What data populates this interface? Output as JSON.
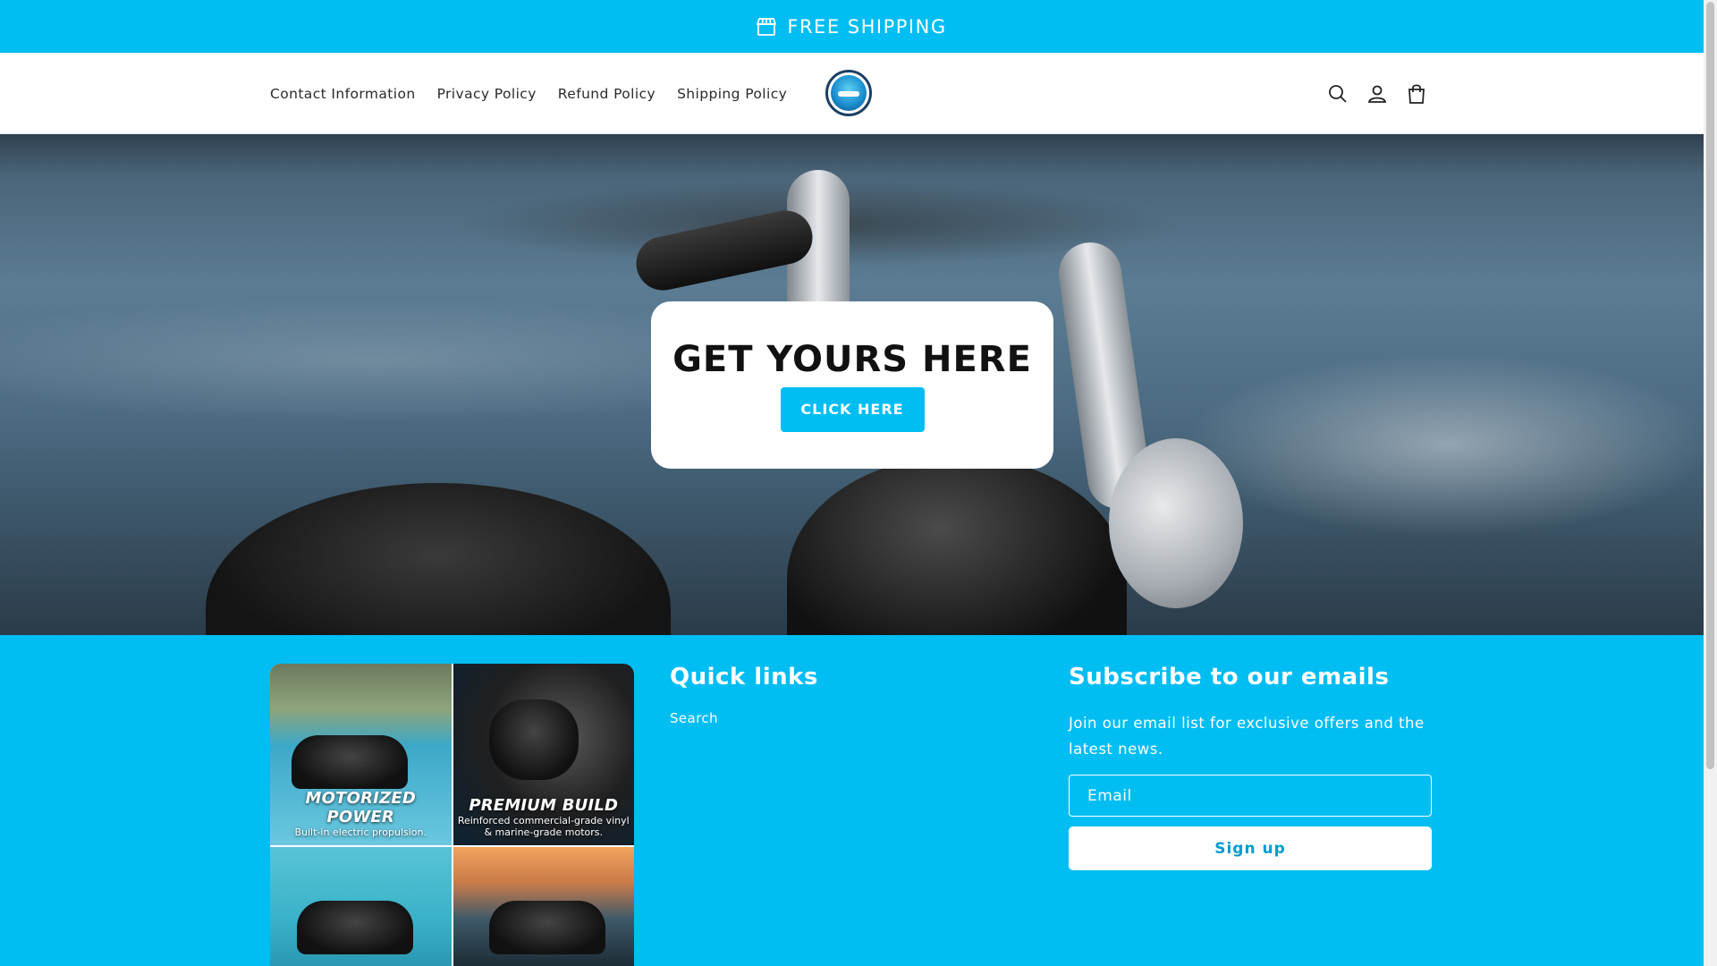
{
  "announcement": {
    "text": "FREE SHIPPING",
    "icon": "store-icon"
  },
  "header": {
    "nav": [
      {
        "label": "Contact Information"
      },
      {
        "label": "Privacy Policy"
      },
      {
        "label": "Refund Policy"
      },
      {
        "label": "Shipping Policy"
      }
    ],
    "icons": [
      "search-icon",
      "account-icon",
      "cart-icon"
    ]
  },
  "hero": {
    "title": "GET YOURS HERE",
    "button": "CLICK HERE"
  },
  "footer": {
    "collage": [
      {
        "title": "MOTORIZED POWER",
        "subtitle": "Built-in electric propulsion."
      },
      {
        "title": "PREMIUM BUILD",
        "subtitle": "Reinforced commercial-grade vinyl & marine-grade motors."
      }
    ],
    "quick_links": {
      "heading": "Quick links",
      "links": [
        {
          "label": "Search"
        }
      ]
    },
    "subscribe": {
      "heading": "Subscribe to our emails",
      "description": "Join our email list for exclusive offers and the latest news.",
      "email_placeholder": "Email",
      "button": "Sign up"
    }
  },
  "colors": {
    "accent": "#00bdf2",
    "white": "#ffffff",
    "text": "#1a1a1a"
  }
}
